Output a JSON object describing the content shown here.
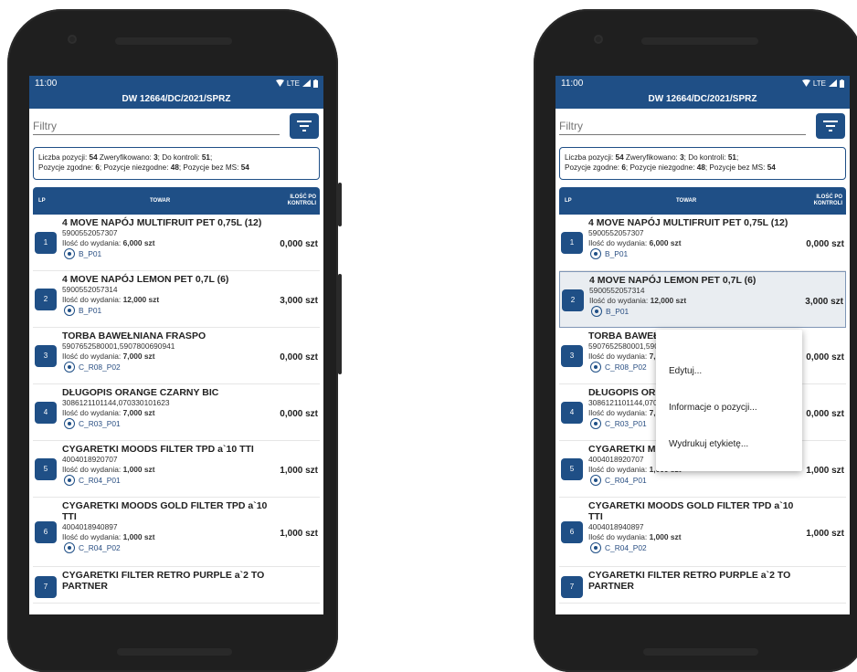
{
  "status": {
    "time": "11:00",
    "network": "LTE"
  },
  "document": {
    "title": "DW 12664/DC/2021/SPRZ"
  },
  "filter": {
    "placeholder": "Filtry"
  },
  "summary": {
    "l1_a": "Liczba pozycji: ",
    "total": "54",
    "l1_b": " Zweryfikowano: ",
    "verified": "3",
    "l1_c": "; Do kontroli: ",
    "to_check": "51",
    "l1_d": ";",
    "l2_a": "Pozycje zgodne: ",
    "matching": "6",
    "l2_b": "; Pozycje niezgodne: ",
    "mismatching": "48",
    "l2_c": "; Pozycje bez MS: ",
    "no_ms": "54"
  },
  "table": {
    "col_lp": "LP",
    "col_towar": "TOWAR",
    "col_qty_1": "ILOŚĆ PO",
    "col_qty_2": "KONTROLI"
  },
  "issue_label": "Ilość do wydania: ",
  "items": [
    {
      "lp": "1",
      "name": "4 MOVE NAPÓJ MULTIFRUIT PET 0,75L (12)",
      "code": "5900552057307",
      "issue": "6,000 szt",
      "loc": "B_P01",
      "qty": "0,000 szt"
    },
    {
      "lp": "2",
      "name": "4 MOVE NAPÓJ LEMON PET 0,7L (6)",
      "code": "5900552057314",
      "issue": "12,000 szt",
      "loc": "B_P01",
      "qty": "3,000 szt"
    },
    {
      "lp": "3",
      "name": "TORBA BAWEŁNIANA FRASPO",
      "code": "5907652580001,5907800690941",
      "issue": "7,000 szt",
      "loc": "C_R08_P02",
      "qty": "0,000 szt"
    },
    {
      "lp": "4",
      "name": "DŁUGOPIS ORANGE CZARNY BIC",
      "code": "3086121101144,070330101623",
      "issue": "7,000 szt",
      "loc": "C_R03_P01",
      "qty": "0,000 szt"
    },
    {
      "lp": "5",
      "name": "CYGARETKI MOODS FILTER TPD a`10 TTI",
      "code": "4004018920707",
      "issue": "1,000 szt",
      "loc": "C_R04_P01",
      "qty": "1,000 szt"
    },
    {
      "lp": "6",
      "name": "CYGARETKI MOODS GOLD FILTER TPD a`10 TTI",
      "code": "4004018940897",
      "issue": "1,000 szt",
      "loc": "C_R04_P02",
      "qty": "1,000 szt"
    },
    {
      "lp": "7",
      "name": "CYGARETKI FILTER RETRO PURPLE a`2 TO PARTNER",
      "code": "",
      "issue": "",
      "loc": "",
      "qty": ""
    }
  ],
  "context_menu": {
    "edit": "Edytuj...",
    "info": "Informacje o pozycji...",
    "print": "Wydrukuj etykietę..."
  },
  "colors": {
    "primary": "#1f4f86",
    "highlight": "#e9edf1"
  }
}
